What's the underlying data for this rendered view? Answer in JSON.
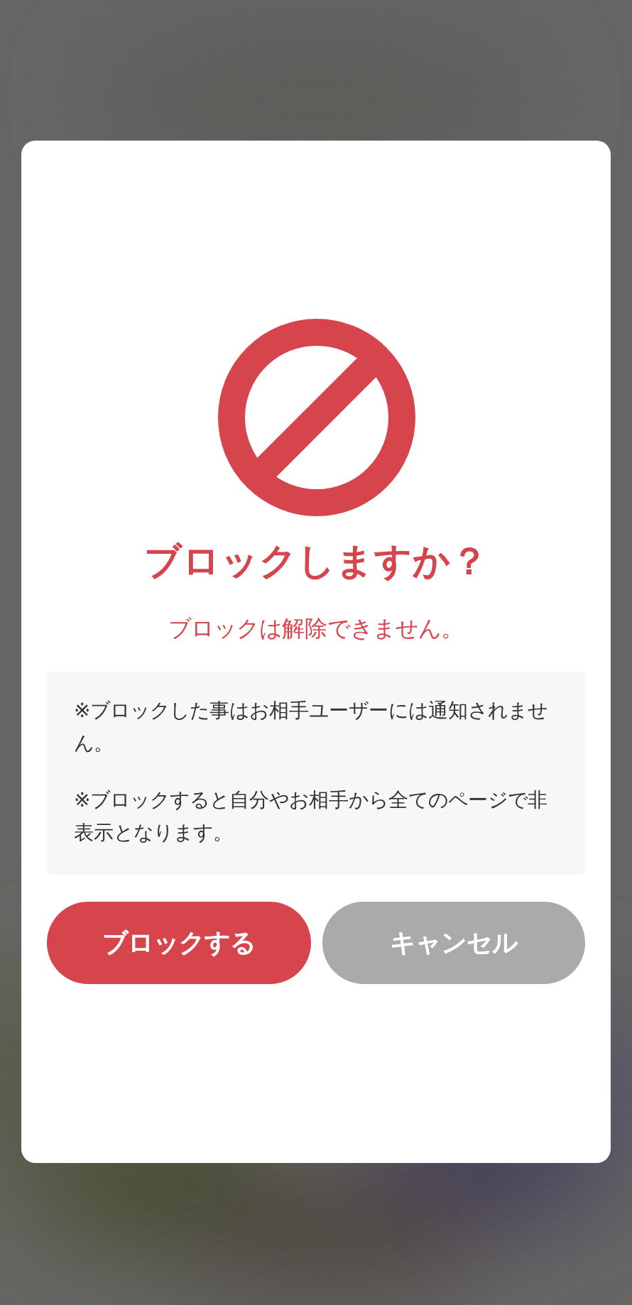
{
  "dialog": {
    "title": "ブロックしますか？",
    "subtitle": "ブロックは解除できません。",
    "notes": [
      "※ブロックした事はお相手ユーザーには通知されません。",
      "※ブロックすると自分やお相手から全てのページで非表示となります。"
    ],
    "buttons": [
      {
        "label": "ブロックする",
        "kind": "primary"
      },
      {
        "label": "キャンセル",
        "kind": "secondary"
      }
    ]
  }
}
